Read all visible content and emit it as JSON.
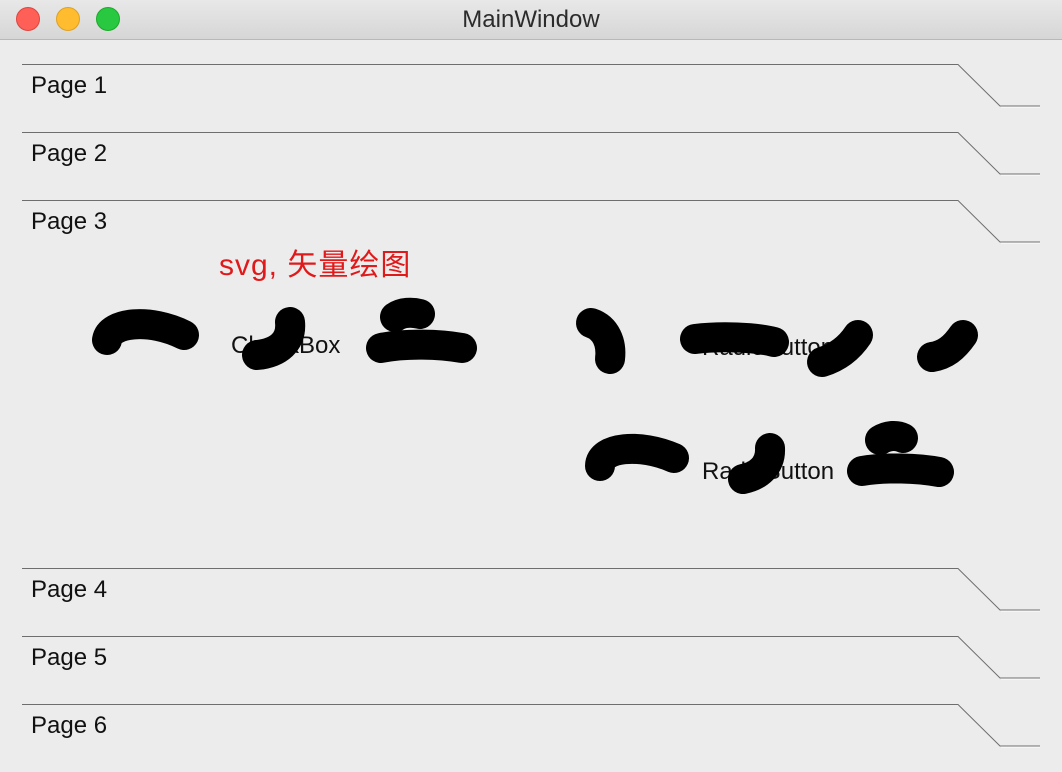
{
  "window": {
    "title": "MainWindow"
  },
  "pages": [
    {
      "label": "Page 1"
    },
    {
      "label": "Page 2"
    },
    {
      "label": "Page 3"
    },
    {
      "label": "Page 4"
    },
    {
      "label": "Page 5"
    },
    {
      "label": "Page 6"
    }
  ],
  "page3": {
    "caption": "svg, 矢量绘图",
    "caption_color": "#e0191b",
    "checkbox_label": "CheckBox",
    "radio1_label": "RadioButton",
    "radio2_label": "RadioButton"
  }
}
